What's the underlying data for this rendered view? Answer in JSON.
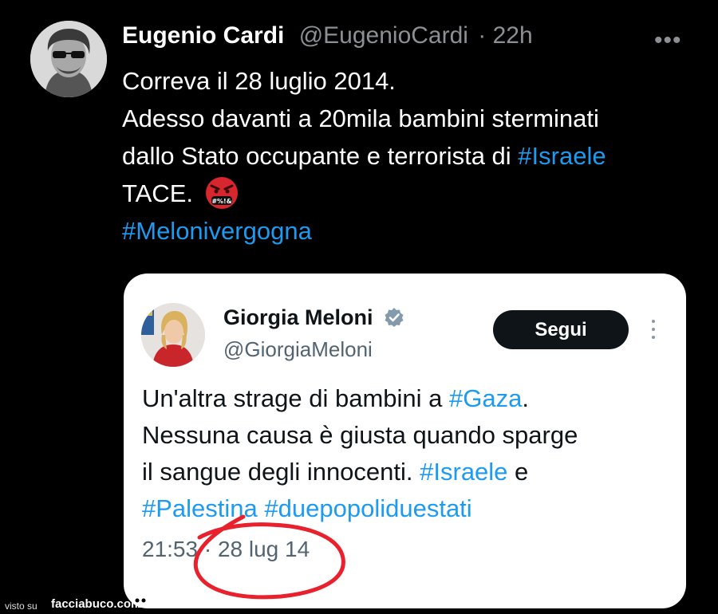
{
  "tweet": {
    "author": {
      "name": "Eugenio Cardi",
      "handle": "@EugenioCardi",
      "time": "· 22h"
    },
    "more_icon": "more-horizontal-icon",
    "text": {
      "line1": "Correva il 28 luglio 2014.",
      "line2": "Adesso davanti a 20mila bambini sterminati",
      "line3_text": "dallo Stato occupante e terrorista di ",
      "line3_hashtag": "#Israele",
      "line4_text": "TACE.",
      "emoji": "face-with-symbols-on-mouth",
      "hashtag_line": "#Melonivergogna"
    }
  },
  "quoted": {
    "name": "Giorgia Meloni",
    "verified_icon": "verified-badge-icon",
    "handle": "@GiorgiaMeloni",
    "follow_label": "Segui",
    "text": {
      "l1_text": "Un'altra strage di bambini a ",
      "l1_hashtag": "#Gaza",
      "l1_end": ".",
      "l2": "Nessuna causa è giusta quando sparge",
      "l3_text": "il sangue degli innocenti. ",
      "l3_hashtag": "#Israele",
      "l3_end": " e",
      "l4_hashtag1": "#Palestina",
      "l4_hashtag2": "#duepopoliduestati"
    },
    "timestamp": "21:53 · 28 lug 14"
  },
  "watermark": {
    "visto": "visto su",
    "site": "facciabuco.com"
  },
  "colors": {
    "hashtag": "#1d9bf0",
    "annotation": "#e8212d",
    "follow_bg": "#0f1419"
  }
}
